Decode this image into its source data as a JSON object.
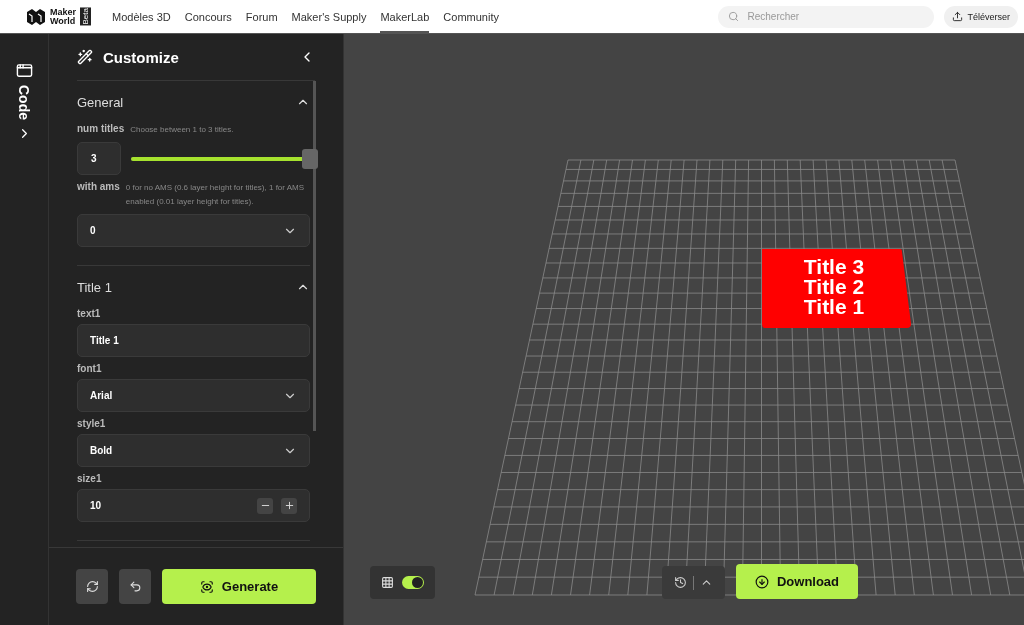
{
  "nav": {
    "logo": {
      "line1": "Maker",
      "line2": "World",
      "badge": "Beta"
    },
    "links": [
      {
        "label": "Modèles 3D",
        "selected": false
      },
      {
        "label": "Concours",
        "selected": false
      },
      {
        "label": "Forum",
        "selected": false
      },
      {
        "label": "Maker's Supply",
        "selected": false
      },
      {
        "label": "MakerLab",
        "selected": true
      },
      {
        "label": "Community",
        "selected": false
      }
    ],
    "search": {
      "placeholder": "Rechercher"
    },
    "upload": "Téléverser"
  },
  "rail": {
    "label": "Code"
  },
  "panel": {
    "title": "Customize",
    "sections": [
      {
        "title": "General",
        "expanded": true,
        "params": [
          {
            "kind": "slider",
            "name": "num titles",
            "hint": "Choose between 1 to 3 titles.",
            "value": "3",
            "level": 1
          },
          {
            "kind": "select",
            "name": "with ams",
            "hint": "0 for no AMS (0.6 layer height for titles), 1 for AMS enabled (0.01 layer height for titles).",
            "value": "0"
          }
        ]
      },
      {
        "title": "Title 1",
        "expanded": true,
        "params": [
          {
            "kind": "text",
            "name": "text1",
            "value": "Title 1"
          },
          {
            "kind": "select",
            "name": "font1",
            "value": "Arial"
          },
          {
            "kind": "select",
            "name": "style1",
            "value": "Bold"
          },
          {
            "kind": "number",
            "name": "size1",
            "value": "10"
          }
        ]
      }
    ],
    "generate": "Generate"
  },
  "viewport": {
    "grid_on": true,
    "plate_texts": [
      "Title 3",
      "Title 2",
      "Title 1"
    ],
    "download": "Download"
  }
}
